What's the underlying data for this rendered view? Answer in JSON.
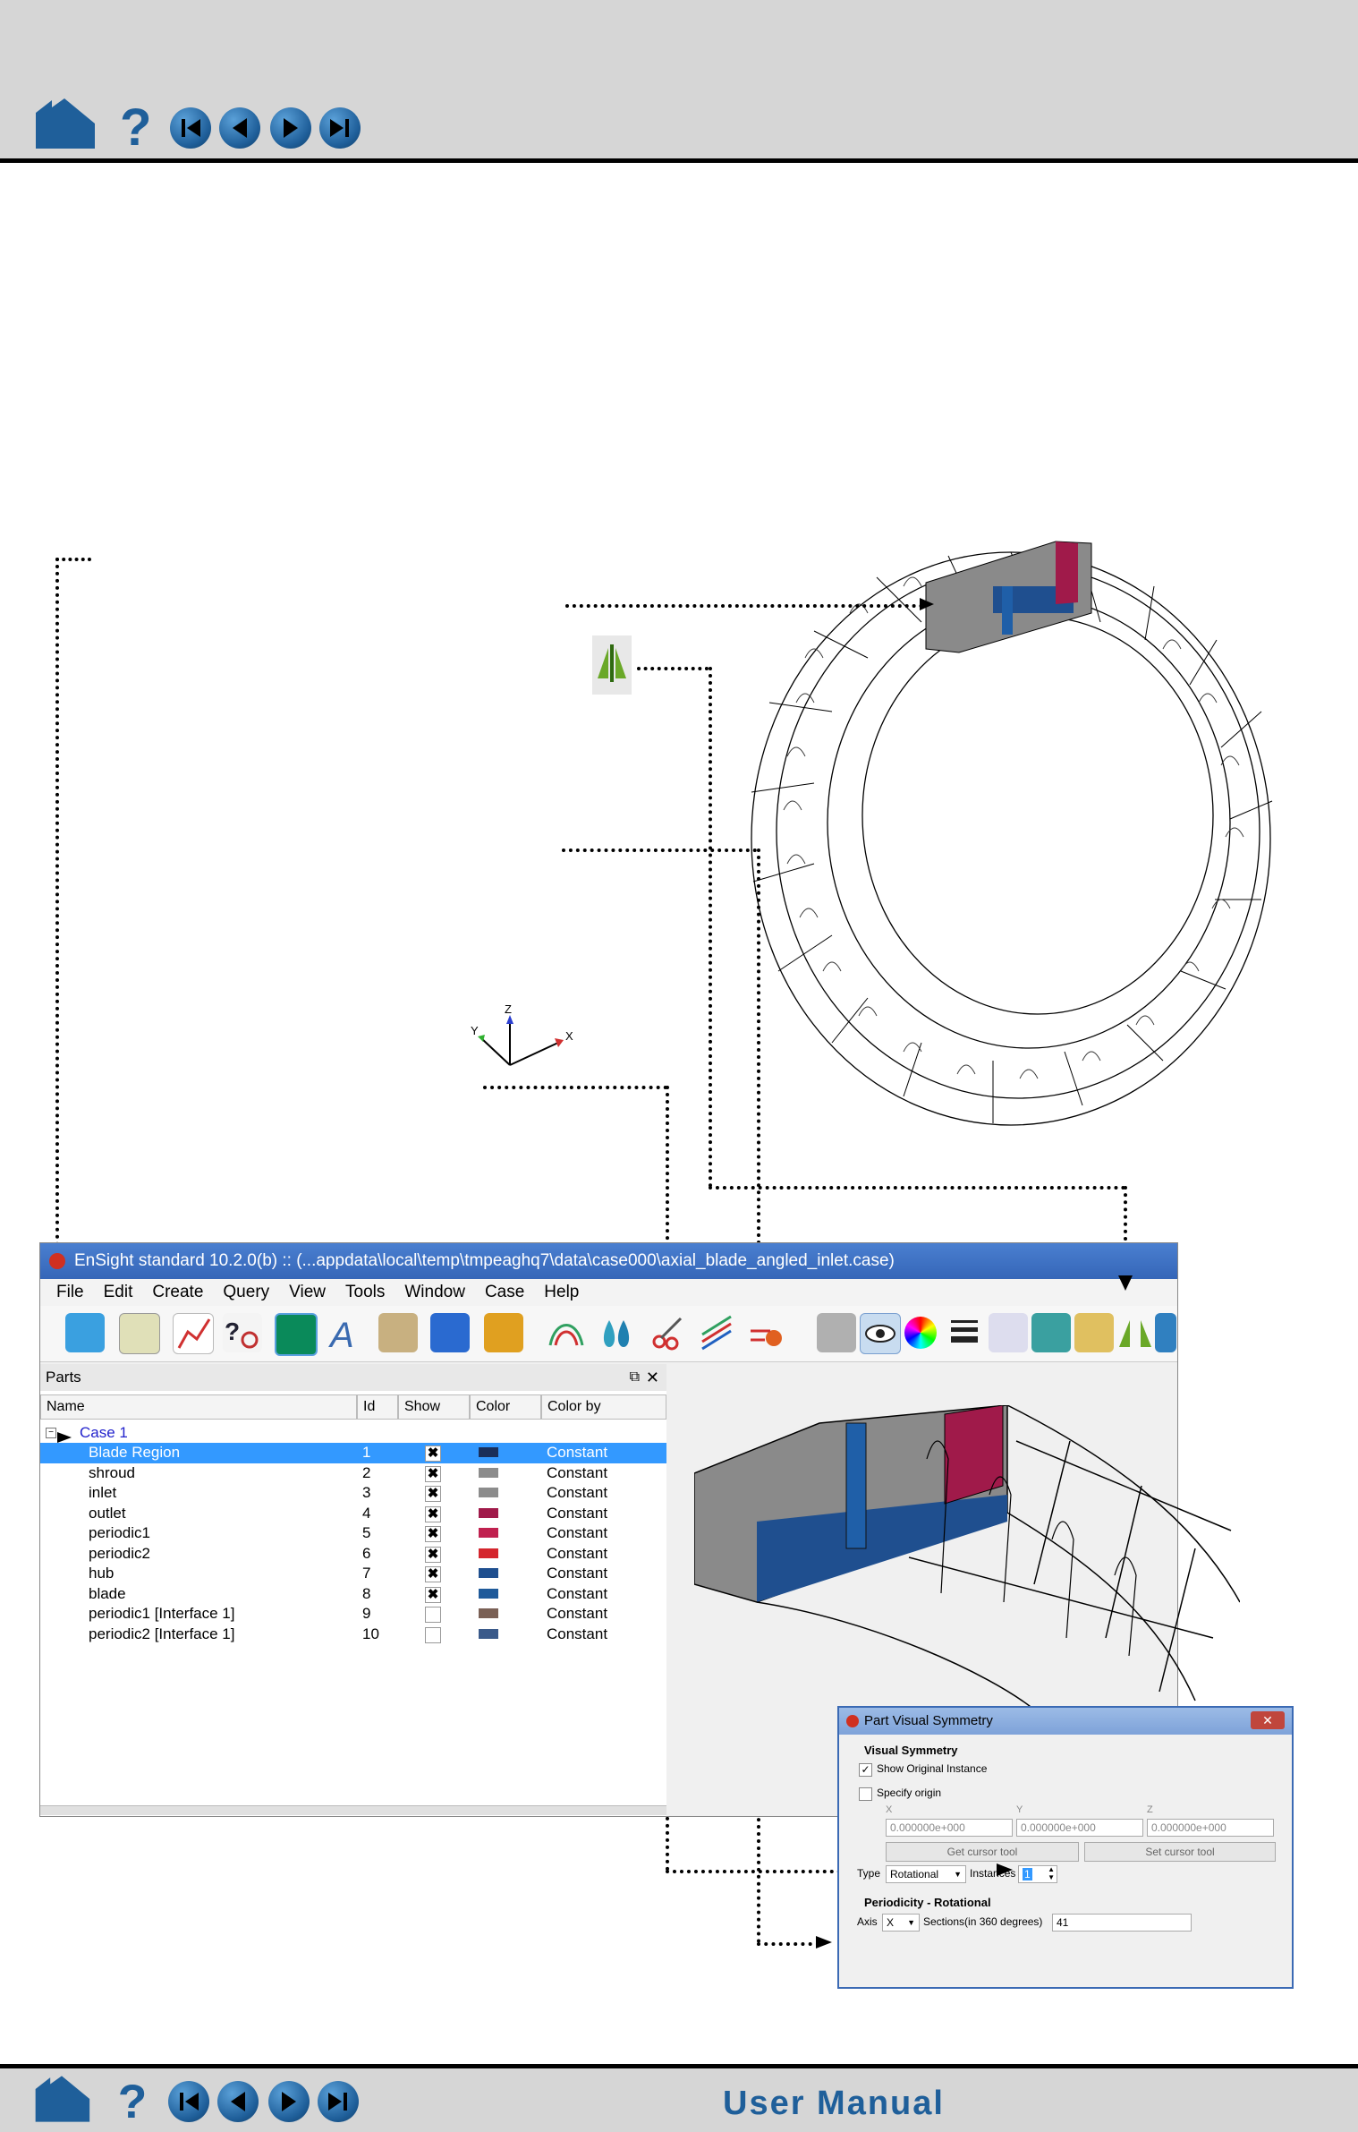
{
  "bottom_bar": {
    "title": "User Manual"
  },
  "axis_triad": {
    "x_label": "X",
    "y_label": "Y",
    "z_label": "Z"
  },
  "ensight": {
    "title": "EnSight standard 10.2.0(b) ::  (...appdata\\local\\temp\\tmpeaghq7\\data\\case000\\axial_blade_angled_inlet.case)",
    "menu": [
      "File",
      "Edit",
      "Create",
      "Query",
      "View",
      "Tools",
      "Window",
      "Case",
      "Help"
    ],
    "parts_panel_title": "Parts",
    "columns": [
      "Name",
      "Id",
      "Show",
      "Color",
      "Color by"
    ],
    "case_label": "Case 1",
    "parts": [
      {
        "name": "Blade Region",
        "id": "1",
        "show": true,
        "color": "#1a2f5a",
        "color_by": "Constant",
        "selected": true
      },
      {
        "name": "shroud",
        "id": "2",
        "show": true,
        "color": "#8c8c8c",
        "color_by": "Constant"
      },
      {
        "name": "inlet",
        "id": "3",
        "show": true,
        "color": "#8c8c8c",
        "color_by": "Constant"
      },
      {
        "name": "outlet",
        "id": "4",
        "show": true,
        "color": "#a01a4a",
        "color_by": "Constant"
      },
      {
        "name": "periodic1",
        "id": "5",
        "show": true,
        "color": "#c0214f",
        "color_by": "Constant"
      },
      {
        "name": "periodic2",
        "id": "6",
        "show": true,
        "color": "#d4262e",
        "color_by": "Constant"
      },
      {
        "name": "hub",
        "id": "7",
        "show": true,
        "color": "#1f4f8f",
        "color_by": "Constant"
      },
      {
        "name": "blade",
        "id": "8",
        "show": true,
        "color": "#1f5a9a",
        "color_by": "Constant"
      },
      {
        "name": "periodic1 [Interface 1]",
        "id": "9",
        "show": false,
        "color": "#7a6055",
        "color_by": "Constant"
      },
      {
        "name": "periodic2 [Interface 1]",
        "id": "10",
        "show": false,
        "color": "#3a5a8a",
        "color_by": "Constant"
      }
    ]
  },
  "symmetry_dialog": {
    "title": "Part Visual Symmetry",
    "section_visual": "Visual Symmetry",
    "show_original": "Show Original Instance",
    "specify_origin": "Specify origin",
    "x_label": "X",
    "y_label": "Y",
    "z_label": "Z",
    "x_value": "0.000000e+000",
    "y_value": "0.000000e+000",
    "z_value": "0.000000e+000",
    "get_cursor": "Get cursor tool",
    "set_cursor": "Set cursor tool",
    "type_label": "Type",
    "type_value": "Rotational",
    "instances_label": "Instances",
    "instances_value": "1",
    "section_periodicity": "Periodicity - Rotational",
    "axis_label": "Axis",
    "axis_value": "X",
    "sections_label": "Sections(in 360 degrees)",
    "sections_value": "41"
  }
}
